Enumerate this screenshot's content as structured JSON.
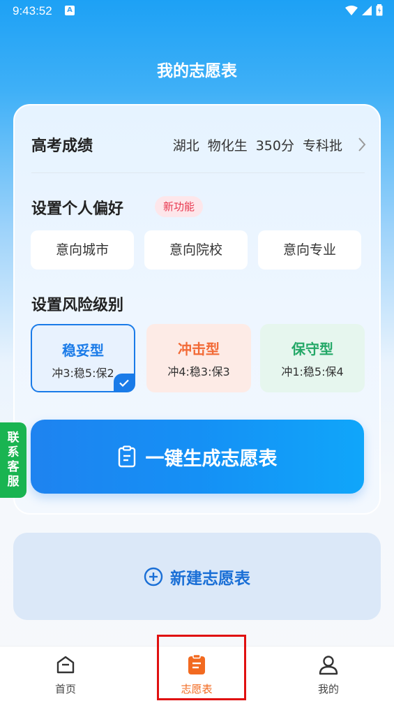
{
  "status_bar": {
    "time": "9:43:52",
    "app_icon": "A"
  },
  "page": {
    "title": "我的志愿表"
  },
  "score": {
    "label": "高考成绩",
    "province": "湖北",
    "subjects": "物化生",
    "points": "350分",
    "batch": "专科批"
  },
  "preferences": {
    "title": "设置个人偏好",
    "badge": "新功能",
    "buttons": [
      "意向城市",
      "意向院校",
      "意向专业"
    ]
  },
  "risk": {
    "title": "设置风险级别",
    "options": [
      {
        "name": "稳妥型",
        "ratio": "冲3:稳5:保2",
        "selected": true,
        "color": "#1a7be8"
      },
      {
        "name": "冲击型",
        "ratio": "冲4:稳3:保3",
        "selected": false,
        "color": "#f26a36"
      },
      {
        "name": "保守型",
        "ratio": "冲1:稳5:保4",
        "selected": false,
        "color": "#23a867"
      }
    ]
  },
  "generate": {
    "label": "一键生成志愿表",
    "icon": "clipboard-icon"
  },
  "service": {
    "label_chars": [
      "联",
      "系",
      "客",
      "服"
    ]
  },
  "new_plan": {
    "label": "新建志愿表",
    "icon": "plus-circle-icon"
  },
  "bottom_nav": {
    "items": [
      {
        "label": "首页",
        "icon": "home-icon",
        "active": false
      },
      {
        "label": "志愿表",
        "icon": "clipboard-icon",
        "active": true
      },
      {
        "label": "我的",
        "icon": "user-icon",
        "active": false
      }
    ]
  },
  "colors": {
    "primary": "#1a7be8",
    "active_tab": "#f26a20",
    "service": "#19b451",
    "highlight": "#e01010"
  }
}
